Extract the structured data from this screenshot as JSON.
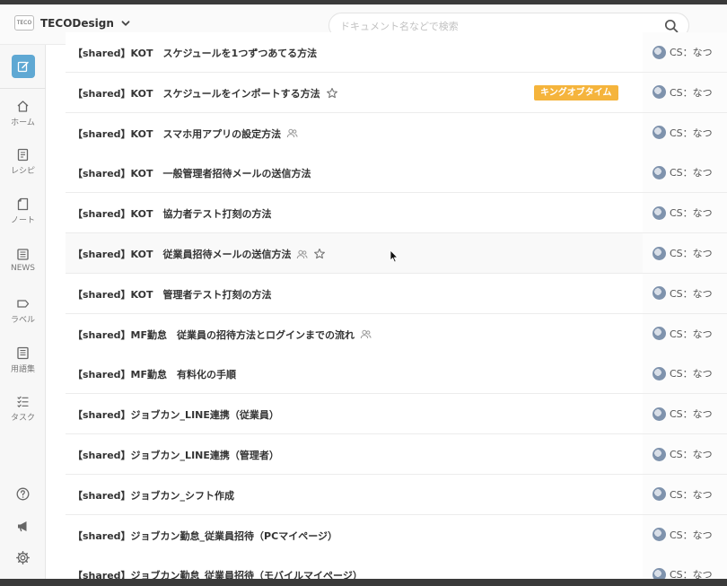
{
  "header": {
    "logo_text": "TECO",
    "workspace_name": "TECODesign",
    "search_placeholder": "ドキュメント名などで検索"
  },
  "sidebar": {
    "items": [
      {
        "label": "ホーム",
        "icon": "home-icon"
      },
      {
        "label": "レシピ",
        "icon": "recipe-icon"
      },
      {
        "label": "ノート",
        "icon": "note-icon"
      },
      {
        "label": "NEWS",
        "icon": "news-icon"
      },
      {
        "label": "ラベル",
        "icon": "label-icon"
      },
      {
        "label": "用語集",
        "icon": "glossary-icon"
      },
      {
        "label": "タスク",
        "icon": "task-icon"
      }
    ],
    "bottom_icons": [
      "help-icon",
      "megaphone-icon",
      "settings-icon"
    ]
  },
  "documents": [
    {
      "title": "【shared】KOT　スケジュールを1つずつあてる方法",
      "author": "CS：なつ"
    },
    {
      "title": "【shared】KOT　スケジュールをインポートする方法",
      "star": true,
      "tag": "キングオブタイム",
      "author": "CS：なつ"
    },
    {
      "title": "【shared】KOT　スマホ用アプリの設定方法",
      "shared": true,
      "author": "CS：なつ"
    },
    {
      "title": "【shared】KOT　一般管理者招待メールの送信方法",
      "author": "CS：なつ"
    },
    {
      "title": "【shared】KOT　協力者テスト打刻の方法",
      "author": "CS：なつ"
    },
    {
      "title": "【shared】KOT　従業員招待メールの送信方法",
      "shared": true,
      "star": true,
      "author": "CS：なつ"
    },
    {
      "title": "【shared】KOT　管理者テスト打刻の方法",
      "author": "CS：なつ"
    },
    {
      "title": "【shared】MF勤怠　従業員の招待方法とログインまでの流れ",
      "shared": true,
      "author": "CS：なつ"
    },
    {
      "title": "【shared】MF勤怠　有料化の手順",
      "author": "CS：なつ"
    },
    {
      "title": "【shared】ジョブカン_LINE連携（従業員）",
      "author": "CS：なつ"
    },
    {
      "title": "【shared】ジョブカン_LINE連携（管理者）",
      "author": "CS：なつ"
    },
    {
      "title": "【shared】ジョブカン_シフト作成",
      "author": "CS：なつ"
    },
    {
      "title": "【shared】ジョブカン勤怠_従業員招待（PCマイページ）",
      "author": "CS：なつ"
    },
    {
      "title": "【shared】ジョブカン勤怠_従業員招待（モバイルマイページ）",
      "author": "CS：なつ"
    }
  ],
  "colors": {
    "accent": "#5fa8d3",
    "tag": "#f5b43c"
  }
}
